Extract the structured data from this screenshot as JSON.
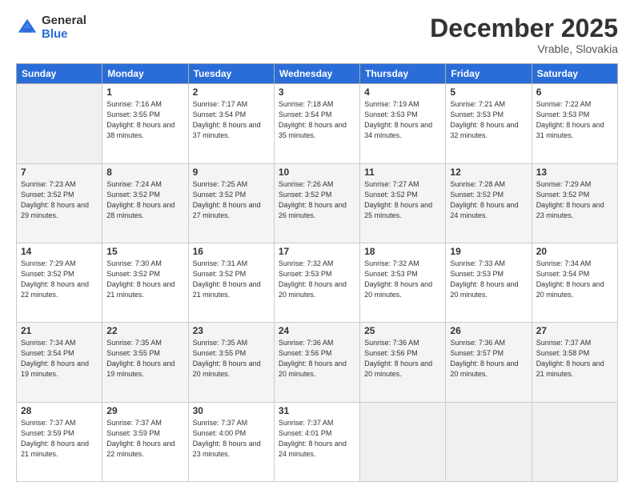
{
  "header": {
    "logo_general": "General",
    "logo_blue": "Blue",
    "month_title": "December 2025",
    "location": "Vrable, Slovakia"
  },
  "days_of_week": [
    "Sunday",
    "Monday",
    "Tuesday",
    "Wednesday",
    "Thursday",
    "Friday",
    "Saturday"
  ],
  "weeks": [
    [
      {
        "day": "",
        "sunrise": "",
        "sunset": "",
        "daylight": ""
      },
      {
        "day": "1",
        "sunrise": "Sunrise: 7:16 AM",
        "sunset": "Sunset: 3:55 PM",
        "daylight": "Daylight: 8 hours and 38 minutes."
      },
      {
        "day": "2",
        "sunrise": "Sunrise: 7:17 AM",
        "sunset": "Sunset: 3:54 PM",
        "daylight": "Daylight: 8 hours and 37 minutes."
      },
      {
        "day": "3",
        "sunrise": "Sunrise: 7:18 AM",
        "sunset": "Sunset: 3:54 PM",
        "daylight": "Daylight: 8 hours and 35 minutes."
      },
      {
        "day": "4",
        "sunrise": "Sunrise: 7:19 AM",
        "sunset": "Sunset: 3:53 PM",
        "daylight": "Daylight: 8 hours and 34 minutes."
      },
      {
        "day": "5",
        "sunrise": "Sunrise: 7:21 AM",
        "sunset": "Sunset: 3:53 PM",
        "daylight": "Daylight: 8 hours and 32 minutes."
      },
      {
        "day": "6",
        "sunrise": "Sunrise: 7:22 AM",
        "sunset": "Sunset: 3:53 PM",
        "daylight": "Daylight: 8 hours and 31 minutes."
      }
    ],
    [
      {
        "day": "7",
        "sunrise": "Sunrise: 7:23 AM",
        "sunset": "Sunset: 3:52 PM",
        "daylight": "Daylight: 8 hours and 29 minutes."
      },
      {
        "day": "8",
        "sunrise": "Sunrise: 7:24 AM",
        "sunset": "Sunset: 3:52 PM",
        "daylight": "Daylight: 8 hours and 28 minutes."
      },
      {
        "day": "9",
        "sunrise": "Sunrise: 7:25 AM",
        "sunset": "Sunset: 3:52 PM",
        "daylight": "Daylight: 8 hours and 27 minutes."
      },
      {
        "day": "10",
        "sunrise": "Sunrise: 7:26 AM",
        "sunset": "Sunset: 3:52 PM",
        "daylight": "Daylight: 8 hours and 26 minutes."
      },
      {
        "day": "11",
        "sunrise": "Sunrise: 7:27 AM",
        "sunset": "Sunset: 3:52 PM",
        "daylight": "Daylight: 8 hours and 25 minutes."
      },
      {
        "day": "12",
        "sunrise": "Sunrise: 7:28 AM",
        "sunset": "Sunset: 3:52 PM",
        "daylight": "Daylight: 8 hours and 24 minutes."
      },
      {
        "day": "13",
        "sunrise": "Sunrise: 7:29 AM",
        "sunset": "Sunset: 3:52 PM",
        "daylight": "Daylight: 8 hours and 23 minutes."
      }
    ],
    [
      {
        "day": "14",
        "sunrise": "Sunrise: 7:29 AM",
        "sunset": "Sunset: 3:52 PM",
        "daylight": "Daylight: 8 hours and 22 minutes."
      },
      {
        "day": "15",
        "sunrise": "Sunrise: 7:30 AM",
        "sunset": "Sunset: 3:52 PM",
        "daylight": "Daylight: 8 hours and 21 minutes."
      },
      {
        "day": "16",
        "sunrise": "Sunrise: 7:31 AM",
        "sunset": "Sunset: 3:52 PM",
        "daylight": "Daylight: 8 hours and 21 minutes."
      },
      {
        "day": "17",
        "sunrise": "Sunrise: 7:32 AM",
        "sunset": "Sunset: 3:53 PM",
        "daylight": "Daylight: 8 hours and 20 minutes."
      },
      {
        "day": "18",
        "sunrise": "Sunrise: 7:32 AM",
        "sunset": "Sunset: 3:53 PM",
        "daylight": "Daylight: 8 hours and 20 minutes."
      },
      {
        "day": "19",
        "sunrise": "Sunrise: 7:33 AM",
        "sunset": "Sunset: 3:53 PM",
        "daylight": "Daylight: 8 hours and 20 minutes."
      },
      {
        "day": "20",
        "sunrise": "Sunrise: 7:34 AM",
        "sunset": "Sunset: 3:54 PM",
        "daylight": "Daylight: 8 hours and 20 minutes."
      }
    ],
    [
      {
        "day": "21",
        "sunrise": "Sunrise: 7:34 AM",
        "sunset": "Sunset: 3:54 PM",
        "daylight": "Daylight: 8 hours and 19 minutes."
      },
      {
        "day": "22",
        "sunrise": "Sunrise: 7:35 AM",
        "sunset": "Sunset: 3:55 PM",
        "daylight": "Daylight: 8 hours and 19 minutes."
      },
      {
        "day": "23",
        "sunrise": "Sunrise: 7:35 AM",
        "sunset": "Sunset: 3:55 PM",
        "daylight": "Daylight: 8 hours and 20 minutes."
      },
      {
        "day": "24",
        "sunrise": "Sunrise: 7:36 AM",
        "sunset": "Sunset: 3:56 PM",
        "daylight": "Daylight: 8 hours and 20 minutes."
      },
      {
        "day": "25",
        "sunrise": "Sunrise: 7:36 AM",
        "sunset": "Sunset: 3:56 PM",
        "daylight": "Daylight: 8 hours and 20 minutes."
      },
      {
        "day": "26",
        "sunrise": "Sunrise: 7:36 AM",
        "sunset": "Sunset: 3:57 PM",
        "daylight": "Daylight: 8 hours and 20 minutes."
      },
      {
        "day": "27",
        "sunrise": "Sunrise: 7:37 AM",
        "sunset": "Sunset: 3:58 PM",
        "daylight": "Daylight: 8 hours and 21 minutes."
      }
    ],
    [
      {
        "day": "28",
        "sunrise": "Sunrise: 7:37 AM",
        "sunset": "Sunset: 3:59 PM",
        "daylight": "Daylight: 8 hours and 21 minutes."
      },
      {
        "day": "29",
        "sunrise": "Sunrise: 7:37 AM",
        "sunset": "Sunset: 3:59 PM",
        "daylight": "Daylight: 8 hours and 22 minutes."
      },
      {
        "day": "30",
        "sunrise": "Sunrise: 7:37 AM",
        "sunset": "Sunset: 4:00 PM",
        "daylight": "Daylight: 8 hours and 23 minutes."
      },
      {
        "day": "31",
        "sunrise": "Sunrise: 7:37 AM",
        "sunset": "Sunset: 4:01 PM",
        "daylight": "Daylight: 8 hours and 24 minutes."
      },
      {
        "day": "",
        "sunrise": "",
        "sunset": "",
        "daylight": ""
      },
      {
        "day": "",
        "sunrise": "",
        "sunset": "",
        "daylight": ""
      },
      {
        "day": "",
        "sunrise": "",
        "sunset": "",
        "daylight": ""
      }
    ]
  ]
}
